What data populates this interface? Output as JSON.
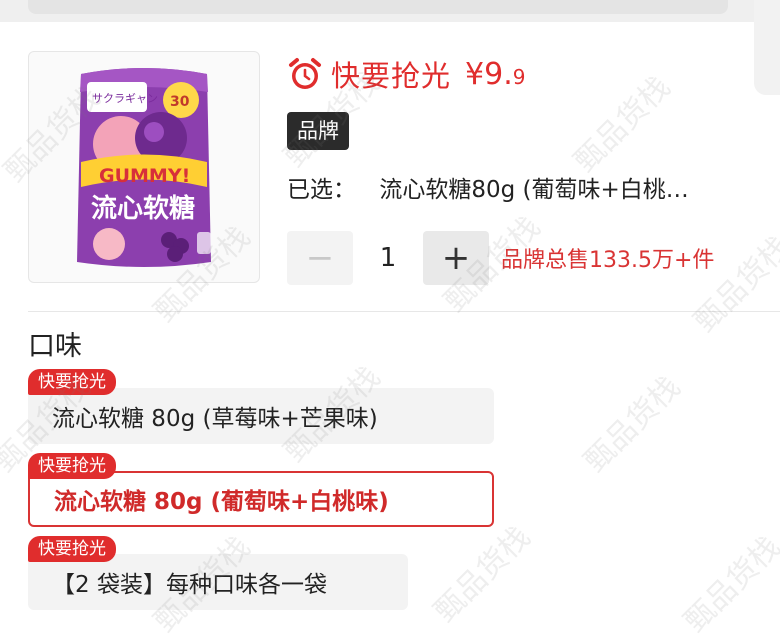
{
  "product": {
    "image_label": "product-image",
    "flash_sale_label": "快要抢光",
    "price_main": "¥9.",
    "price_decimal": "9",
    "brand_badge": "品牌",
    "selected_label": "已选：",
    "selected_value": "流心软糖80g (葡萄味+白桃…",
    "quantity": "1",
    "minus_symbol": "−",
    "plus_symbol": "+",
    "total_sales": "品牌总售133.5万+件"
  },
  "flavor": {
    "title": "口味",
    "options": [
      {
        "tag": "快要抢光",
        "label": "流心软糖 80g (草莓味+芒果味)",
        "selected": false
      },
      {
        "tag": "快要抢光",
        "label": "流心软糖 80g (葡萄味+白桃味)",
        "selected": true
      },
      {
        "tag": "快要抢光",
        "label": "【2 袋装】每种口味各一袋",
        "selected": false
      }
    ]
  },
  "watermark": "甄品货栈",
  "colors": {
    "accent": "#e02d2d",
    "badge": "#2b2b2b"
  }
}
